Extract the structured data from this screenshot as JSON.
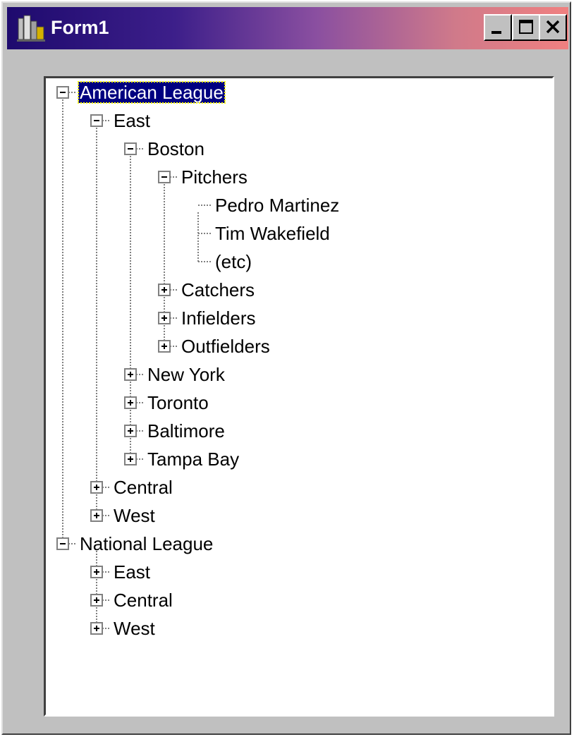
{
  "window": {
    "title": "Form1"
  },
  "tree": {
    "nodes": [
      {
        "label": "American League",
        "state": "expanded",
        "selected": true
      },
      {
        "label": "East",
        "state": "expanded"
      },
      {
        "label": "Boston",
        "state": "expanded"
      },
      {
        "label": "Pitchers",
        "state": "expanded"
      },
      {
        "label": "Pedro Martinez",
        "state": "leaf"
      },
      {
        "label": "Tim Wakefield",
        "state": "leaf"
      },
      {
        "label": "(etc)",
        "state": "leaf"
      },
      {
        "label": "Catchers",
        "state": "collapsed"
      },
      {
        "label": "Infielders",
        "state": "collapsed"
      },
      {
        "label": "Outfielders",
        "state": "collapsed"
      },
      {
        "label": "New York",
        "state": "collapsed"
      },
      {
        "label": "Toronto",
        "state": "collapsed"
      },
      {
        "label": "Baltimore",
        "state": "collapsed"
      },
      {
        "label": "Tampa Bay",
        "state": "collapsed"
      },
      {
        "label": "Central",
        "state": "collapsed"
      },
      {
        "label": "West",
        "state": "collapsed"
      },
      {
        "label": "National League",
        "state": "expanded"
      },
      {
        "label": "East",
        "state": "collapsed"
      },
      {
        "label": "Central",
        "state": "collapsed"
      },
      {
        "label": "West",
        "state": "collapsed"
      }
    ]
  },
  "colors": {
    "selection_bg": "#000080",
    "selection_text": "#ffffff",
    "window_face": "#c0c0c0"
  }
}
